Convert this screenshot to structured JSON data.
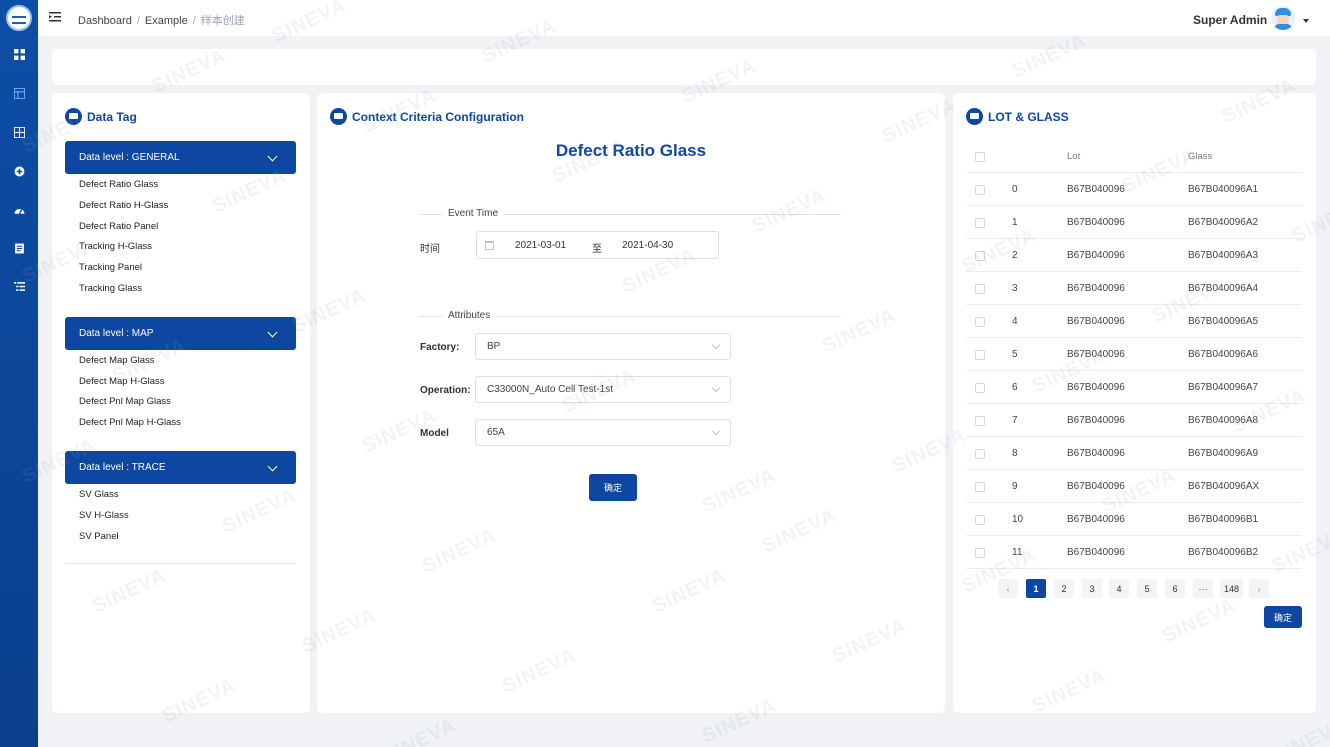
{
  "header": {
    "breadcrumb": [
      "Dashboard",
      "Example",
      "样本创建"
    ],
    "user_name": "Super Admin"
  },
  "sidebar": {
    "items": [
      "grid-icon",
      "grid-icon",
      "grid-icon",
      "plus-circle-icon",
      "dashboard-icon",
      "document-icon",
      "list-icon"
    ]
  },
  "data_tag": {
    "title": "Data Tag",
    "groups": [
      {
        "label": "Data level : GENERAL",
        "items": [
          "Defect Ratio Glass",
          "Defect Ratio H-Glass",
          "Defect Ratio Panel",
          "Tracking H-Glass",
          "Tracking Panel",
          "Tracking Glass"
        ]
      },
      {
        "label": "Data level : MAP",
        "items": [
          "Defect Map Glass",
          "Defect Map H-Glass",
          "Defect Pnl Map Glass",
          "Defect Pnl Map H-Glass"
        ]
      },
      {
        "label": "Data level : TRACE",
        "items": [
          "SV Glass",
          "SV H-Glass",
          "SV Panel"
        ]
      }
    ]
  },
  "context": {
    "title": "Context Criteria Configuration",
    "form_title": "Defect Ratio Glass",
    "event_time_label": "Event Time",
    "time_label": "时间",
    "date_start": "2021-03-01",
    "date_sep": "至",
    "date_end": "2021-04-30",
    "attributes_label": "Attributes",
    "factory_label": "Factory:",
    "factory_value": "BP",
    "operation_label": "Operation:",
    "operation_value": "C33000N_Auto Cell Test-1st",
    "model_label": "Model",
    "model_value": "65A",
    "confirm": "确定"
  },
  "lot_glass": {
    "title": "LOT & GLASS",
    "columns": [
      "Lot",
      "Glass"
    ],
    "rows": [
      {
        "idx": "0",
        "lot": "B67B040096",
        "glass": "B67B040096A1"
      },
      {
        "idx": "1",
        "lot": "B67B040096",
        "glass": "B67B040096A2"
      },
      {
        "idx": "2",
        "lot": "B67B040096",
        "glass": "B67B040096A3"
      },
      {
        "idx": "3",
        "lot": "B67B040096",
        "glass": "B67B040096A4"
      },
      {
        "idx": "4",
        "lot": "B67B040096",
        "glass": "B67B040096A5"
      },
      {
        "idx": "5",
        "lot": "B67B040096",
        "glass": "B67B040096A6"
      },
      {
        "idx": "6",
        "lot": "B67B040096",
        "glass": "B67B040096A7"
      },
      {
        "idx": "7",
        "lot": "B67B040096",
        "glass": "B67B040096A8"
      },
      {
        "idx": "8",
        "lot": "B67B040096",
        "glass": "B67B040096A9"
      },
      {
        "idx": "9",
        "lot": "B67B040096",
        "glass": "B67B040096AX"
      },
      {
        "idx": "10",
        "lot": "B67B040096",
        "glass": "B67B040096B1"
      },
      {
        "idx": "11",
        "lot": "B67B040096",
        "glass": "B67B040096B2"
      }
    ],
    "pagination": [
      "1",
      "2",
      "3",
      "4",
      "5",
      "6",
      "···",
      "148"
    ],
    "current_page": "1",
    "confirm": "确定"
  },
  "watermark": "SINEVA",
  "colors": {
    "primary": "#0d47a1",
    "sidebar": "#0d4ea6",
    "background": "#f0f2f5"
  }
}
